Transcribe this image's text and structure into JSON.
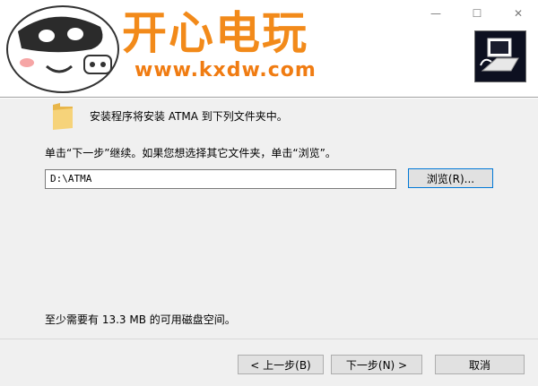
{
  "window": {
    "minimize_glyph": "—",
    "maximize_glyph": "☐",
    "close_glyph": "✕"
  },
  "header": {
    "brand_cn": "开心电玩",
    "brand_url": "www.kxdw.com"
  },
  "body": {
    "intro_text": "安装程序将安装 ATMA 到下列文件夹中。",
    "hint_text": "单击“下一步”继续。如果您想选择其它文件夹，单击“浏览”。",
    "install_path": "D:\\ATMA",
    "browse_label": "浏览(R)...",
    "space_text": "至少需要有 13.3 MB 的可用磁盘空间。"
  },
  "footer": {
    "back_label": "< 上一步(B)",
    "next_label": "下一步(N) >",
    "cancel_label": "取消"
  },
  "colors": {
    "brand_orange": "#f28a1a",
    "focus_blue": "#0078d7"
  },
  "icons": {
    "folder": "folder-icon",
    "app": "app-icon",
    "mascot": "mascot-logo"
  }
}
